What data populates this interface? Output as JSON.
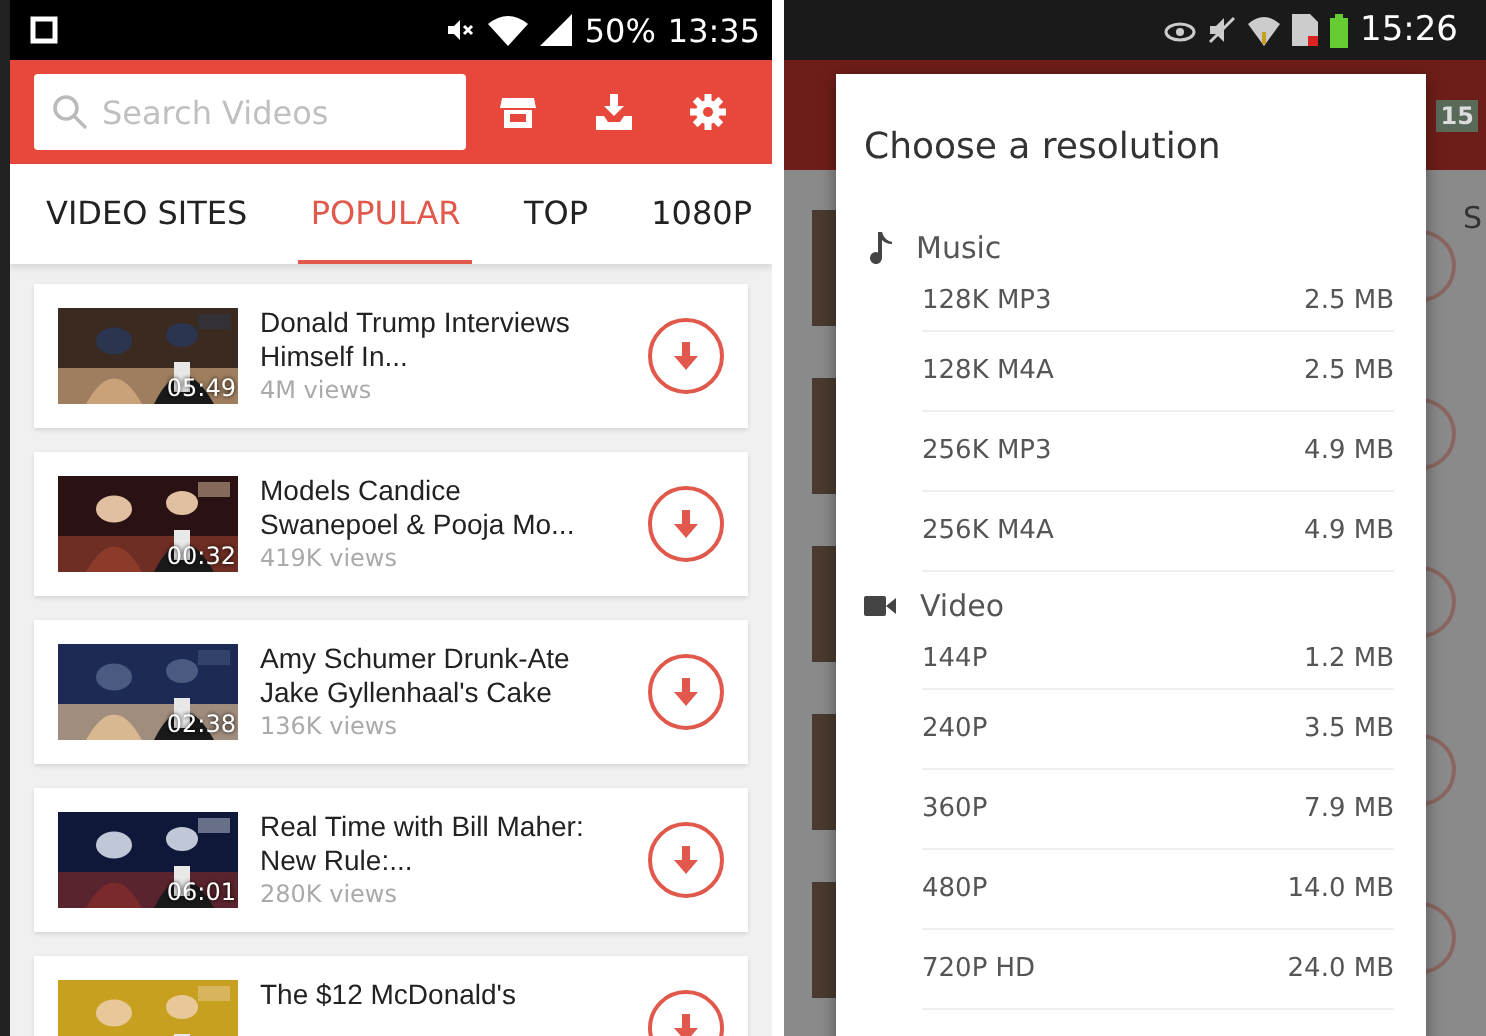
{
  "left_phone": {
    "status_bar": {
      "battery": "50%",
      "time": "13:35"
    },
    "search": {
      "placeholder": "Search Videos"
    },
    "tabs": [
      {
        "label": "VIDEO SITES",
        "selected": false
      },
      {
        "label": "POPULAR",
        "selected": true
      },
      {
        "label": "TOP",
        "selected": false
      },
      {
        "label": "1080P",
        "selected": false
      }
    ],
    "videos": [
      {
        "title": "Donald Trump Interviews Himself In...",
        "views": "4M views",
        "duration": "05:49"
      },
      {
        "title": "Models Candice Swanepoel & Pooja Mo...",
        "views": "419K views",
        "duration": "00:32"
      },
      {
        "title": "Amy Schumer Drunk-Ate Jake Gyllenhaal's Cake",
        "views": "136K views",
        "duration": "02:38"
      },
      {
        "title": "Real Time with Bill Maher: New Rule:...",
        "views": "280K views",
        "duration": "06:01"
      },
      {
        "title": "The $12 McDonald's"
      }
    ]
  },
  "right_phone": {
    "status_bar": {
      "time": "15:26"
    },
    "background": {
      "badge": "15",
      "tab_fragment": "S"
    },
    "dialog": {
      "title": "Choose a resolution",
      "sections": [
        {
          "kind": "music",
          "label": "Music",
          "options": [
            {
              "label": "128K MP3",
              "size": "2.5 MB"
            },
            {
              "label": "128K M4A",
              "size": "2.5 MB"
            },
            {
              "label": "256K MP3",
              "size": "4.9 MB"
            },
            {
              "label": "256K M4A",
              "size": "4.9 MB"
            }
          ]
        },
        {
          "kind": "video",
          "label": "Video",
          "options": [
            {
              "label": "144P",
              "size": "1.2 MB"
            },
            {
              "label": "240P",
              "size": "3.5 MB"
            },
            {
              "label": "360P",
              "size": "7.9 MB"
            },
            {
              "label": "480P",
              "size": "14.0 MB"
            },
            {
              "label": "720P HD",
              "size": "24.0 MB"
            }
          ]
        }
      ]
    }
  }
}
